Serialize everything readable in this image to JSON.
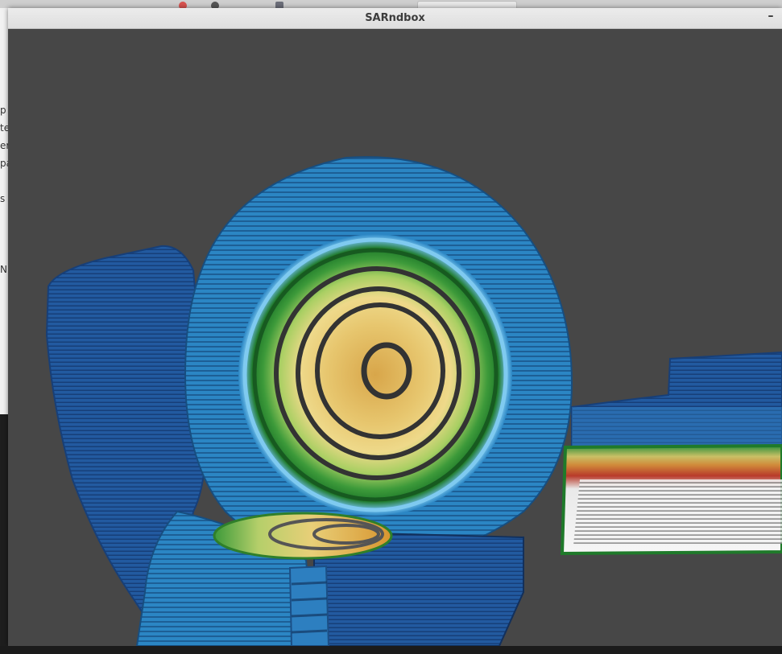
{
  "window": {
    "title": "SARndbox",
    "minimize_glyph": "–"
  },
  "background_app": {
    "partial_lines": [
      "p",
      "te",
      "er",
      "pa",
      "s",
      "N"
    ]
  },
  "colors": {
    "window_bg": "#474747",
    "deep_blue": "#1f5fa8",
    "mid_blue": "#2b86c4",
    "light_blue": "#5fb3e0",
    "green_dark": "#1f7a2a",
    "green_light": "#9cc95a",
    "sand_yellow": "#e8cf78",
    "sand_orange": "#d89a3e",
    "red": "#b83a2a",
    "snow": "#f2f2f2"
  },
  "icons": {
    "minimize": "minimize-icon"
  }
}
